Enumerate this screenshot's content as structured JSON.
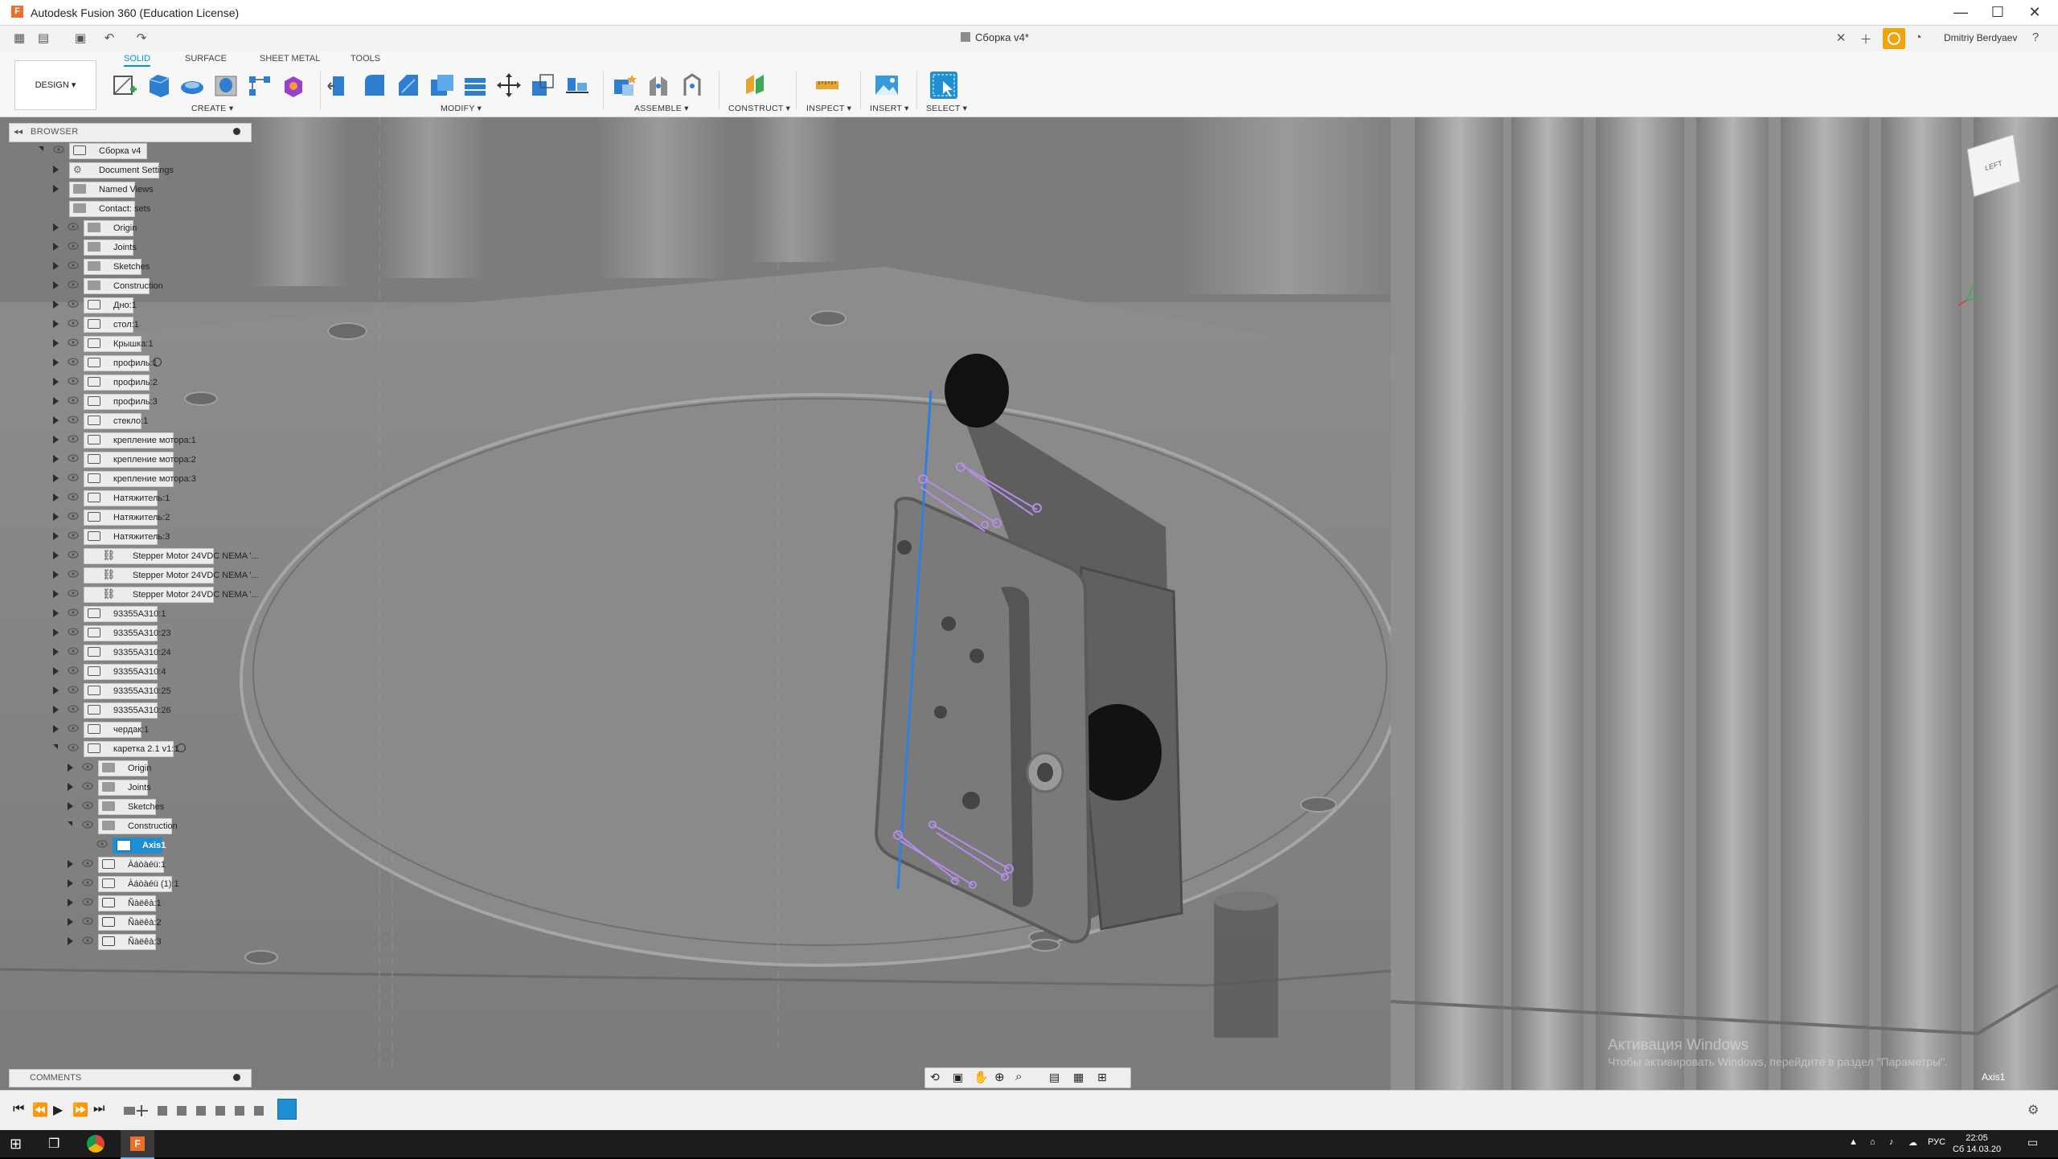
{
  "window": {
    "title": "Autodesk Fusion 360 (Education License)",
    "minimize": "—",
    "maximize": "☐",
    "close": "✕"
  },
  "qab": {
    "document_tab": "Сборка v4*",
    "user_name": "Dmitriy Berdyaev"
  },
  "ribbon": {
    "workspace_button": "DESIGN ▾",
    "tabs": [
      "SOLID",
      "SURFACE",
      "SHEET METAL",
      "TOOLS"
    ],
    "groups": {
      "create": "CREATE ▾",
      "modify": "MODIFY ▾",
      "assemble": "ASSEMBLE ▾",
      "construct": "CONSTRUCT ▾",
      "inspect": "INSPECT ▾",
      "insert": "INSERT ▾",
      "select": "SELECT ▾"
    }
  },
  "browser": {
    "header": "BROWSER",
    "items": [
      {
        "label": "Сборка v4"
      },
      {
        "label": "Document Settings"
      },
      {
        "label": "Named Views"
      },
      {
        "label": "Contact: sets"
      },
      {
        "label": "Origin"
      },
      {
        "label": "Joints"
      },
      {
        "label": "Sketches"
      },
      {
        "label": "Construction"
      },
      {
        "label": "Дно:1"
      },
      {
        "label": "стол:1"
      },
      {
        "label": "Крышка:1"
      },
      {
        "label": "профиль:1"
      },
      {
        "label": "профиль:2"
      },
      {
        "label": "профиль:3"
      },
      {
        "label": "стекло:1"
      },
      {
        "label": "крепление мотора:1"
      },
      {
        "label": "крепление мотора:2"
      },
      {
        "label": "крепление мотора:3"
      },
      {
        "label": "Натяжитель:1"
      },
      {
        "label": "Натяжитель:2"
      },
      {
        "label": "Натяжитель:3"
      },
      {
        "label": "Stepper Motor 24VDC NEMA '..."
      },
      {
        "label": "Stepper Motor 24VDC NEMA '..."
      },
      {
        "label": "Stepper Motor 24VDC NEMA '..."
      },
      {
        "label": "93355A310:1"
      },
      {
        "label": "93355A310:23"
      },
      {
        "label": "93355A310:24"
      },
      {
        "label": "93355A310:4"
      },
      {
        "label": "93355A310:25"
      },
      {
        "label": "93355A310:26"
      },
      {
        "label": "чердак:1"
      },
      {
        "label": "каретка 2.1 v1:1"
      },
      {
        "label": "Origin"
      },
      {
        "label": "Joints"
      },
      {
        "label": "Sketches"
      },
      {
        "label": "Construction"
      },
      {
        "label": "Axis1"
      },
      {
        "label": "Àáòàéü:1"
      },
      {
        "label": "Àáòàéü (1):1"
      },
      {
        "label": "Ñàëêà:1"
      },
      {
        "label": "Ñàëêà:2"
      },
      {
        "label": "Ñàëêà:3"
      }
    ]
  },
  "comments": {
    "header": "COMMENTS"
  },
  "viewport": {
    "viewcube_face": "LEFT",
    "selection": "Axis1",
    "watermark_title": "Активация Windows",
    "watermark_text": "Чтобы активировать Windows, перейдите в раздел \"Параметры\"."
  },
  "taskbar": {
    "language": "РУС",
    "time": "22:05",
    "date": "Сб 14.03.20"
  },
  "colors": {
    "accent": "#0696d7",
    "selection": "#1f8fd4",
    "sketch": "#b58ce6",
    "axis": "#2f7fe0"
  }
}
